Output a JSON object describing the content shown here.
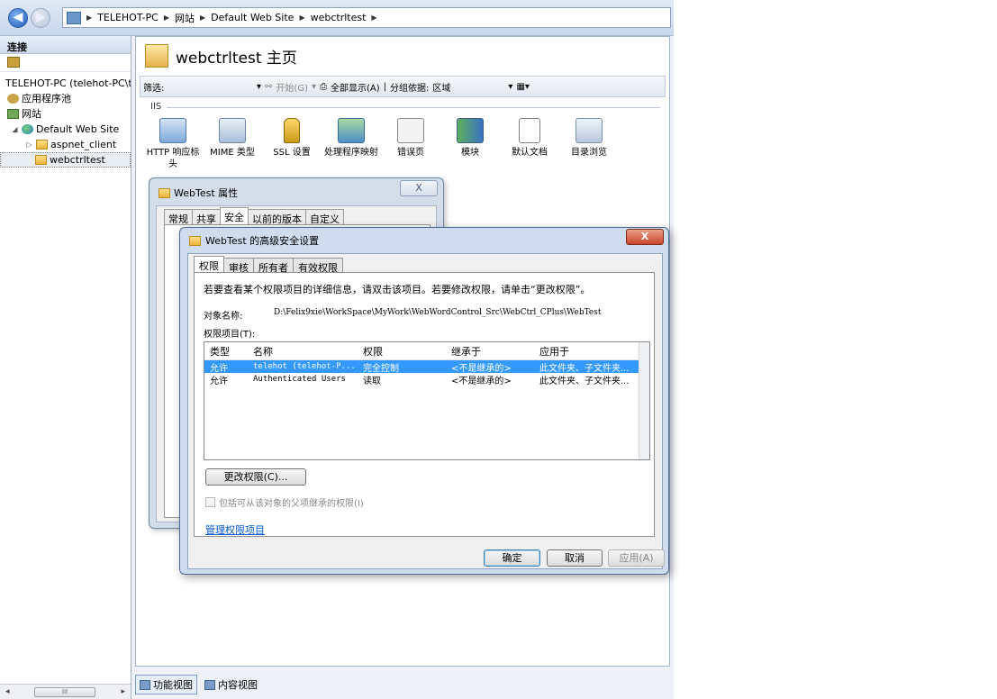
{
  "address": {
    "crumbs": [
      "TELEHOT-PC",
      "网站",
      "Default Web Site",
      "webctrltest"
    ]
  },
  "left_panel": {
    "header": "连接",
    "tree": [
      {
        "label": "TELEHOT-PC (telehot-PC\\te",
        "icon": "server-icon"
      },
      {
        "label": "应用程序池",
        "icon": "app-pool-icon"
      },
      {
        "label": "网站",
        "icon": "sites-icon"
      },
      {
        "label": "Default Web Site",
        "icon": "globe-icon"
      },
      {
        "label": "aspnet_client",
        "icon": "folder-icon"
      },
      {
        "label": "webctrltest",
        "icon": "folder-icon"
      }
    ],
    "scroll_label": "III"
  },
  "content": {
    "title": "webctrltest 主页",
    "filter_label": "筛选:",
    "start_label": "开始(G)",
    "showall_label": "全部显示(A)",
    "groupby_label": "分组依据:",
    "groupby_value": "区域",
    "section": "IIS",
    "features": [
      {
        "label": "HTTP 响应标头",
        "icon": "http-headers-icon"
      },
      {
        "label": "MIME 类型",
        "icon": "mime-types-icon"
      },
      {
        "label": "SSL 设置",
        "icon": "ssl-lock-icon"
      },
      {
        "label": "处理程序映射",
        "icon": "handler-mappings-icon"
      },
      {
        "label": "错误页",
        "icon": "error-pages-icon"
      },
      {
        "label": "模块",
        "icon": "modules-icon"
      },
      {
        "label": "默认文档",
        "icon": "default-document-icon"
      },
      {
        "label": "目录浏览",
        "icon": "directory-browsing-icon"
      }
    ]
  },
  "statusbar": {
    "features_view": "功能视图",
    "content_view": "内容视图"
  },
  "props_dialog": {
    "title": "WebTest 属性",
    "close": "X",
    "tabs": [
      "常规",
      "共享",
      "安全",
      "以前的版本",
      "自定义"
    ]
  },
  "adv_dialog": {
    "title": "WebTest 的高级安全设置",
    "close": "X",
    "tabs": [
      "权限",
      "审核",
      "所有者",
      "有效权限"
    ],
    "instruction": "若要查看某个权限项目的详细信息，请双击该项目。若要修改权限，请单击“更改权限”。",
    "object_label": "对象名称:",
    "object_path": "D:\\Felix9xie\\WorkSpace\\MyWork\\WebWordControl_Src\\WebCtrl_CPlus\\WebTest",
    "entries_label": "权限项目(T):",
    "columns": [
      "类型",
      "名称",
      "权限",
      "继承于",
      "应用于"
    ],
    "rows": [
      {
        "type": "允许",
        "name": "telehot (telehot-P...",
        "perm": "完全控制",
        "inherited": "<不是继承的>",
        "apply": "此文件夹、子文件夹..."
      },
      {
        "type": "允许",
        "name": "Authenticated Users",
        "perm": "读取",
        "inherited": "<不是继承的>",
        "apply": "此文件夹、子文件夹..."
      }
    ],
    "change_btn": "更改权限(C)...",
    "inherit_chk": "包括可从该对象的父项继承的权限(I)",
    "manage_link": "管理权限项目",
    "ok": "确定",
    "cancel": "取消",
    "apply": "应用(A)"
  }
}
